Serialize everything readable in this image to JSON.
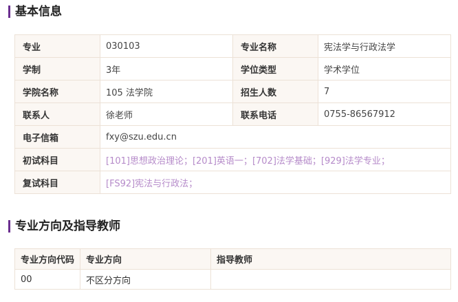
{
  "basic_info": {
    "title": "基本信息",
    "rows": [
      {
        "l1": "专业",
        "v1": "030103",
        "l2": "专业名称",
        "v2": "宪法学与行政法学"
      },
      {
        "l1": "学制",
        "v1": "3年",
        "l2": "学位类型",
        "v2": "学术学位"
      },
      {
        "l1": "学院名称",
        "v1": "105 法学院",
        "l2": "招生人数",
        "v2": "7"
      },
      {
        "l1": "联系人",
        "v1": "徐老师",
        "l2": "联系电话",
        "v2": "0755-86567912"
      }
    ],
    "email": {
      "label": "电子信箱",
      "value": "fxy@szu.edu.cn"
    },
    "initial_exam": {
      "label": "初试科目",
      "subjects": [
        "[101]思想政治理论；",
        "[201]英语一；",
        "[702]法学基础；",
        "[929]法学专业；"
      ]
    },
    "retest_exam": {
      "label": "复试科目",
      "subjects": [
        "[FS92]宪法与行政法；"
      ]
    }
  },
  "directions": {
    "title": "专业方向及指导教师",
    "headers": [
      "专业方向代码",
      "专业方向",
      "指导教师"
    ],
    "rows": [
      {
        "code": "00",
        "direction": "不区分方向",
        "advisor": ""
      }
    ]
  },
  "colors": {
    "accent_bar": "#6a2e8f",
    "link": "#b58ac9",
    "label_bg": "#fbf7f3",
    "border": "#ece1d6"
  }
}
